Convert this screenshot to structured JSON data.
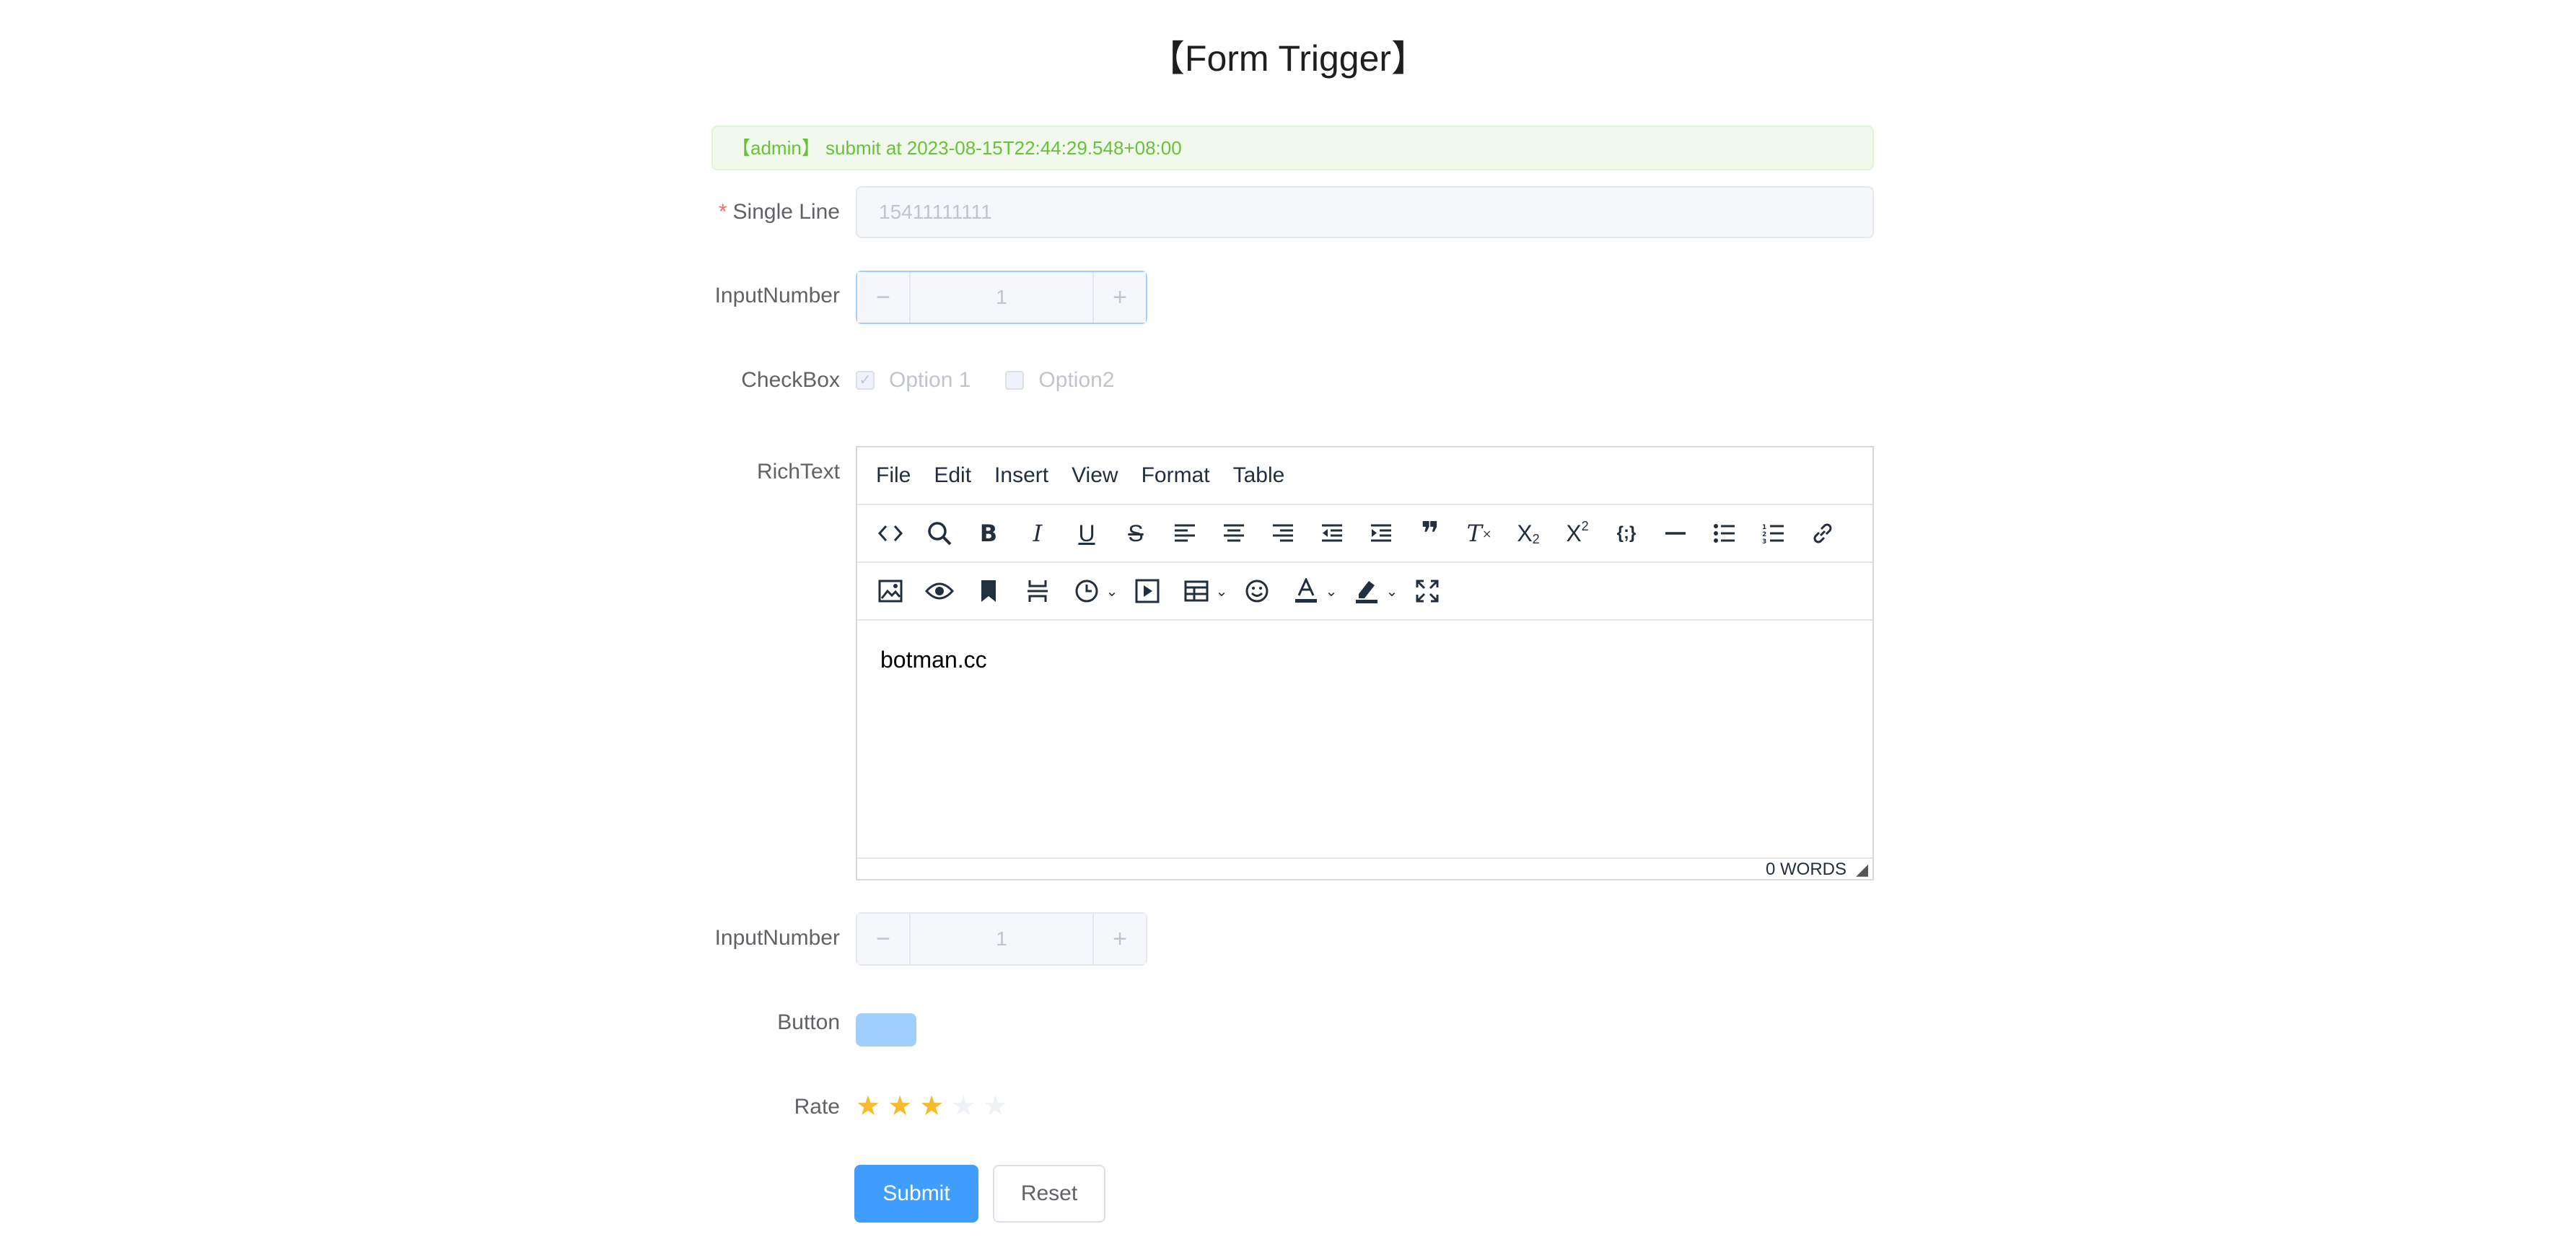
{
  "page": {
    "title": "【Form Trigger】",
    "alert": "【admin】 submit at 2023-08-15T22:44:29.548+08:00"
  },
  "form": {
    "single_line": {
      "label": "Single Line",
      "required_mark": "*",
      "value": "15411111111"
    },
    "input_number_1": {
      "label": "InputNumber",
      "value": "1",
      "minus": "−",
      "plus": "+"
    },
    "checkbox": {
      "label": "CheckBox",
      "options": [
        {
          "label": "Option 1",
          "checked": true,
          "mark": "✓"
        },
        {
          "label": "Option2",
          "checked": false,
          "mark": ""
        }
      ]
    },
    "richtext": {
      "label": "RichText",
      "menu": [
        "File",
        "Edit",
        "Insert",
        "View",
        "Format",
        "Table"
      ],
      "toolbar_row1": [
        "code-icon",
        "search-icon",
        "bold-icon",
        "italic-icon",
        "underline-icon",
        "strikethrough-icon",
        "align-left-icon",
        "align-center-icon",
        "align-right-icon",
        "outdent-icon",
        "indent-icon",
        "blockquote-icon",
        "clear-format-icon",
        "subscript-icon",
        "superscript-icon",
        "code-sample-icon",
        "horizontal-rule-icon",
        "bullet-list-icon",
        "numbered-list-icon",
        "link-icon"
      ],
      "toolbar_row2": [
        "image-icon",
        "preview-icon",
        "bookmark-icon",
        "page-break-icon",
        "datetime-icon",
        "media-icon",
        "table-icon",
        "emoji-icon",
        "text-color-icon",
        "highlight-color-icon",
        "fullscreen-icon"
      ],
      "content": "botman.cc",
      "word_count": "0 WORDS"
    },
    "input_number_2": {
      "label": "InputNumber",
      "value": "1",
      "minus": "−",
      "plus": "+"
    },
    "button": {
      "label": "Button"
    },
    "rate": {
      "label": "Rate",
      "value": 3,
      "max": 5
    },
    "actions": {
      "submit": "Submit",
      "reset": "Reset"
    }
  },
  "colors": {
    "primary": "#409eff",
    "success_text": "#67c23a",
    "success_bg": "#f0f9eb",
    "star": "#f7ba2a",
    "required": "#f56c6c"
  }
}
